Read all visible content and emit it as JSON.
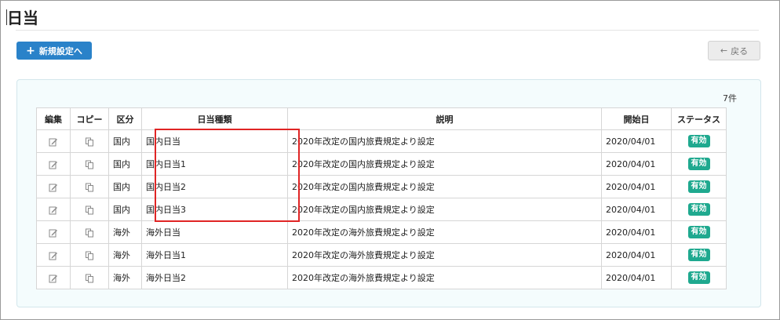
{
  "header": {
    "title": "日当"
  },
  "toolbar": {
    "new_label": "新規設定へ",
    "back_label": "戻る"
  },
  "icons": {
    "add": "plus-icon",
    "back": "arrow-left-icon",
    "edit": "edit-icon",
    "copy": "copy-icon"
  },
  "colors": {
    "primary": "#2a82c9",
    "status": "#1fa98f",
    "highlight": "#e02525",
    "panel": "#f4fcfd"
  },
  "table": {
    "count": "7件",
    "columns": [
      "編集",
      "コピー",
      "区分",
      "日当種類",
      "説明",
      "開始日",
      "ステータス"
    ],
    "rows": [
      {
        "kubun": "国内",
        "type": "国内日当",
        "desc": "2020年改定の国内旅費規定より設定",
        "start": "2020/04/01",
        "status": "有効"
      },
      {
        "kubun": "国内",
        "type": "国内日当1",
        "desc": "2020年改定の国内旅費規定より設定",
        "start": "2020/04/01",
        "status": "有効"
      },
      {
        "kubun": "国内",
        "type": "国内日当2",
        "desc": "2020年改定の国内旅費規定より設定",
        "start": "2020/04/01",
        "status": "有効"
      },
      {
        "kubun": "国内",
        "type": "国内日当3",
        "desc": "2020年改定の国内旅費規定より設定",
        "start": "2020/04/01",
        "status": "有効"
      },
      {
        "kubun": "海外",
        "type": "海外日当",
        "desc": "2020年改定の海外旅費規定より設定",
        "start": "2020/04/01",
        "status": "有効"
      },
      {
        "kubun": "海外",
        "type": "海外日当1",
        "desc": "2020年改定の海外旅費規定より設定",
        "start": "2020/04/01",
        "status": "有効"
      },
      {
        "kubun": "海外",
        "type": "海外日当2",
        "desc": "2020年改定の海外旅費規定より設定",
        "start": "2020/04/01",
        "status": "有効"
      }
    ]
  }
}
